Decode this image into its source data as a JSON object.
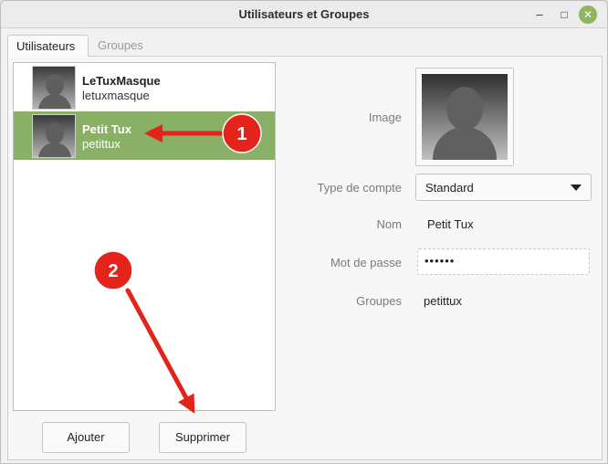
{
  "window": {
    "title": "Utilisateurs et Groupes"
  },
  "tabs": [
    {
      "label": "Utilisateurs",
      "active": true
    },
    {
      "label": "Groupes",
      "active": false
    }
  ],
  "users": [
    {
      "name": "LeTuxMasque",
      "login": "letuxmasque",
      "selected": false
    },
    {
      "name": "Petit Tux",
      "login": "petittux",
      "selected": true
    }
  ],
  "buttons": {
    "add": "Ajouter",
    "remove": "Supprimer"
  },
  "details": {
    "image_label": "Image",
    "account_type_label": "Type de compte",
    "account_type_value": "Standard",
    "name_label": "Nom",
    "name_value": "Petit Tux",
    "password_label": "Mot de passe",
    "password_value": "••••••",
    "groups_label": "Groupes",
    "groups_value": "petittux"
  },
  "annotations": [
    {
      "number": "1"
    },
    {
      "number": "2"
    }
  ],
  "colors": {
    "selection": "#8ab067",
    "annotation": "#e4231b",
    "close_button": "#8fb55e"
  }
}
